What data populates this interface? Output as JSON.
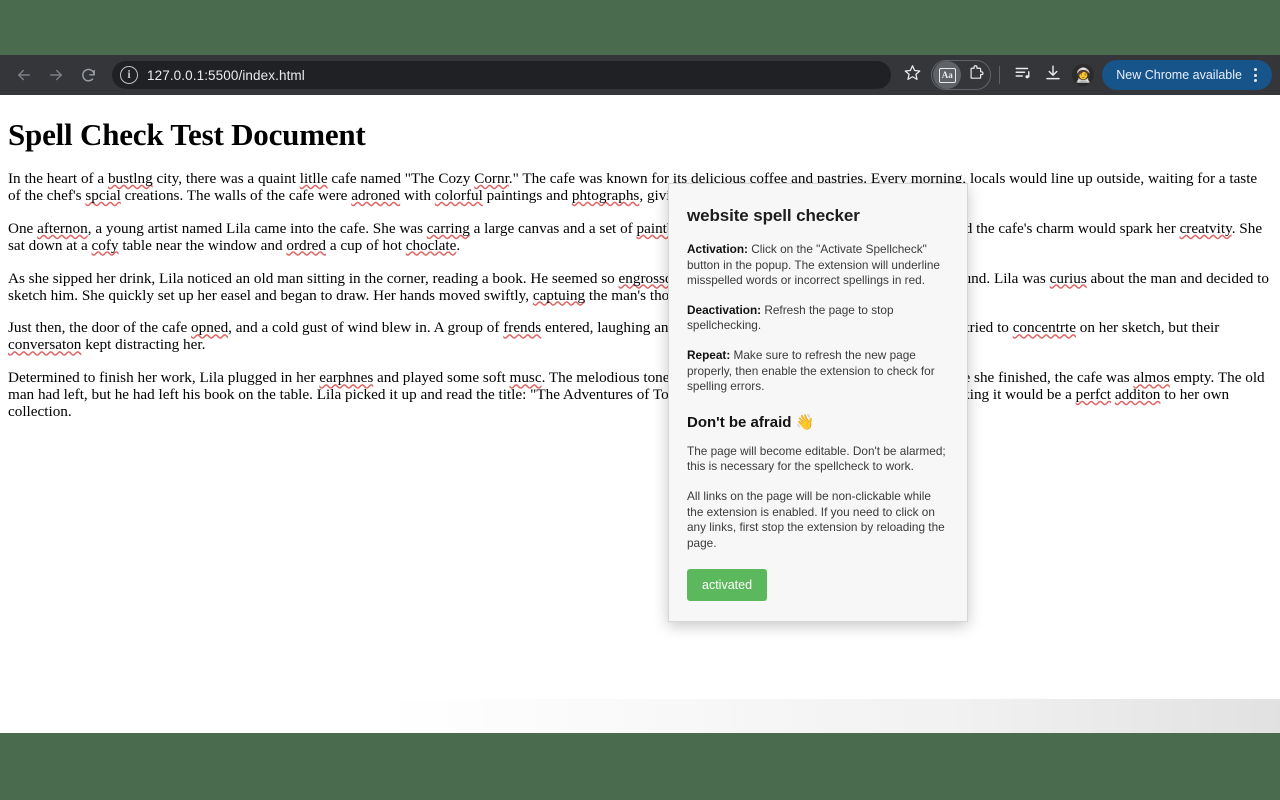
{
  "browser": {
    "back_icon": "back-arrow-icon",
    "forward_icon": "forward-arrow-icon",
    "reload_icon": "reload-icon",
    "site_info_icon": "info-icon",
    "url": "127.0.0.1:5500/index.html",
    "bookmark_icon": "star-icon",
    "extension_active_icon": "Aa",
    "extensions_icon": "puzzle-piece-icon",
    "reading_list_icon": "reading-list-icon",
    "downloads_icon": "download-icon",
    "profile_avatar": "profile-avatar",
    "update_label": "New Chrome available",
    "menu_icon": "three-dot-menu-icon",
    "accent_blue": "#17548a",
    "toolbar_bg": "#35363a",
    "omnibox_bg": "#202124",
    "desktop_bg": "#4a6b4d"
  },
  "document": {
    "title": "Spell Check Test Document",
    "paragraphs": [
      [
        {
          "t": "In the heart of a "
        },
        {
          "t": "bustlng",
          "sp": true
        },
        {
          "t": " city, there was a quaint "
        },
        {
          "t": "litlle",
          "sp": true
        },
        {
          "t": " cafe named \"The Cozy "
        },
        {
          "t": "Cornr",
          "sp": true
        },
        {
          "t": ".\" The cafe was known for its "
        },
        {
          "t": "delicious",
          "sp": true
        },
        {
          "t": " coffee and pastries. Every morning, locals would line up outside, waiting for a taste of the chef's "
        },
        {
          "t": "spcial",
          "sp": true
        },
        {
          "t": " creations. The walls of the cafe were "
        },
        {
          "t": "adroned",
          "sp": true
        },
        {
          "t": " with "
        },
        {
          "t": "colorful",
          "sp": true
        },
        {
          "t": " paintings and "
        },
        {
          "t": "phtographs",
          "sp": true
        },
        {
          "t": ", giving it a warm and inviting atmosphere."
        }
      ],
      [
        {
          "t": "One "
        },
        {
          "t": "afternon",
          "sp": true
        },
        {
          "t": ", a young artist named Lila came into the cafe. She was "
        },
        {
          "t": "carring",
          "sp": true
        },
        {
          "t": " a large canvas and a set of "
        },
        {
          "t": "paintbruhes",
          "sp": true
        },
        {
          "t": ". She was looking for inspiration and hoped the cafe's charm would spark her "
        },
        {
          "t": "creatvity",
          "sp": true
        },
        {
          "t": ". She sat down at a "
        },
        {
          "t": "cofy",
          "sp": true
        },
        {
          "t": " table near the window and "
        },
        {
          "t": "ordred",
          "sp": true
        },
        {
          "t": " a cup of hot "
        },
        {
          "t": "choclate",
          "sp": true
        },
        {
          "t": "."
        }
      ],
      [
        {
          "t": "As she sipped her drink, Lila noticed an old man sitting in the corner, reading a book. He seemed so "
        },
        {
          "t": "engrossd",
          "sp": true
        },
        {
          "t": " in his story that he barely noticed the world around. Lila was "
        },
        {
          "t": "curius",
          "sp": true
        },
        {
          "t": " about the man and decided to sketch him. She quickly set up her easel and began to draw. Her hands moved swiftly, "
        },
        {
          "t": "captuing",
          "sp": true
        },
        {
          "t": " the man's thoughtful expression."
        }
      ],
      [
        {
          "t": "Just then, the door of the cafe "
        },
        {
          "t": "opned",
          "sp": true
        },
        {
          "t": ", and a cold gust of wind blew in. A group of "
        },
        {
          "t": "frends",
          "sp": true
        },
        {
          "t": " entered, laughing and chatting about their plans for the evening. Lila tried to "
        },
        {
          "t": "concentrte",
          "sp": true
        },
        {
          "t": " on her sketch, but their "
        },
        {
          "t": "conversaton",
          "sp": true
        },
        {
          "t": " kept distracting her."
        }
      ],
      [
        {
          "t": "Determined to finish her work, Lila plugged in her "
        },
        {
          "t": "earphnes",
          "sp": true
        },
        {
          "t": " and played some soft "
        },
        {
          "t": "musc",
          "sp": true
        },
        {
          "t": ". The melodious tones helped her focus. Hours passed, and by the time she finished, the cafe was "
        },
        {
          "t": "almos",
          "sp": true
        },
        {
          "t": " empty. The old man had left, but he had left his book on the table. Lila picked it up and read the title: \"The Adventures of Tom Sawyer.\" She tucked the book in her bag, thinking it would be a "
        },
        {
          "t": "perfct",
          "sp": true
        },
        {
          "t": " "
        },
        {
          "t": "additon",
          "sp": true
        },
        {
          "t": " to her own collection."
        }
      ]
    ]
  },
  "popup": {
    "title": "website spell checker",
    "sections": [
      {
        "label": "Activation:",
        "text": " Click on the \"Activate Spellcheck\" button in the popup. The extension will underline misspelled words or incorrect spellings in red."
      },
      {
        "label": "Deactivation:",
        "text": " Refresh the page to stop spellchecking."
      },
      {
        "label": "Repeat:",
        "text": " Make sure to refresh the new page properly, then enable the extension to check for spelling errors."
      }
    ],
    "heading2": "Don't be afraid 👋",
    "note1": "The page will become editable. Don't be alarmed; this is necessary for the spellcheck to work.",
    "note2": "All links on the page will be non-clickable while the extension is enabled. If you need to click on any links, first stop the extension by reloading the page.",
    "button_label": "activated",
    "button_color": "#5cb85c"
  }
}
